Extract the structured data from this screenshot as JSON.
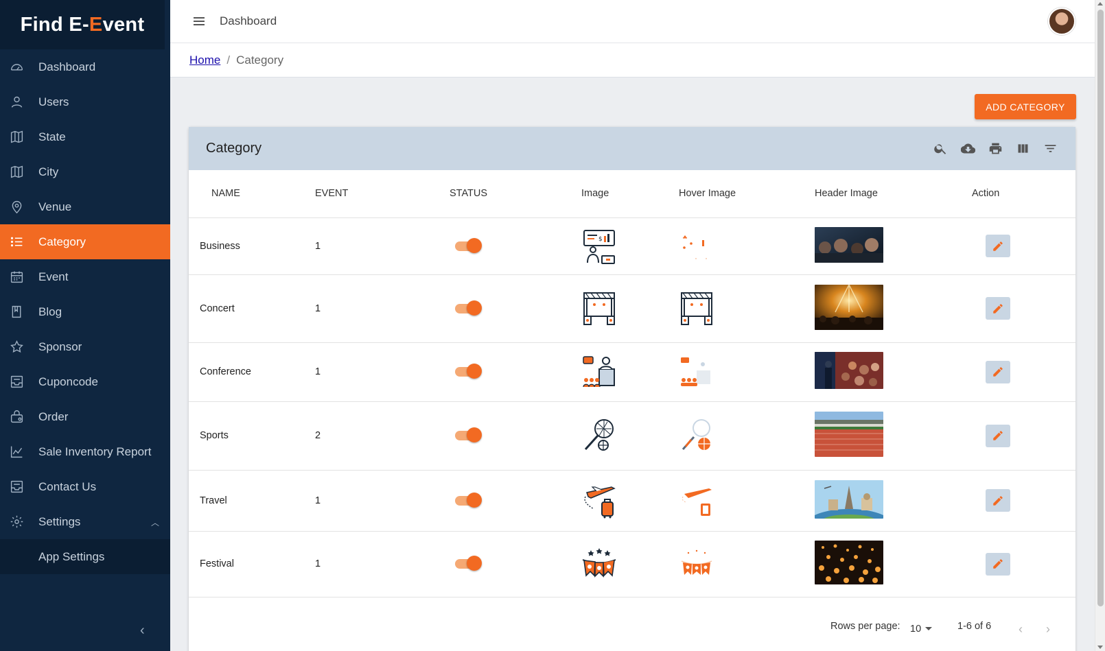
{
  "brand": {
    "part1": "Find E-",
    "part2": "E",
    "part3": "vent"
  },
  "sidebar": {
    "items": [
      {
        "label": "Dashboard",
        "icon": "dashboard-icon"
      },
      {
        "label": "Users",
        "icon": "user-icon"
      },
      {
        "label": "State",
        "icon": "map-icon"
      },
      {
        "label": "City",
        "icon": "map-icon"
      },
      {
        "label": "Venue",
        "icon": "location-pin-icon"
      },
      {
        "label": "Category",
        "icon": "list-icon",
        "active": true
      },
      {
        "label": "Event",
        "icon": "calendar-icon"
      },
      {
        "label": "Blog",
        "icon": "book-icon"
      },
      {
        "label": "Sponsor",
        "icon": "star-icon"
      },
      {
        "label": "Cuponcode",
        "icon": "inbox-icon"
      },
      {
        "label": "Order",
        "icon": "bag-icon"
      },
      {
        "label": "Sale Inventory Report",
        "icon": "chart-line-icon"
      },
      {
        "label": "Contact Us",
        "icon": "inbox-icon"
      },
      {
        "label": "Settings",
        "icon": "gear-icon"
      }
    ],
    "sub_items": [
      {
        "label": "App Settings"
      }
    ]
  },
  "topbar": {
    "title": "Dashboard"
  },
  "breadcrumb": {
    "home": "Home",
    "separator": "/",
    "current": "Category"
  },
  "add_button": "ADD CATEGORY",
  "card": {
    "title": "Category",
    "tools": [
      "search-icon",
      "download-icon",
      "print-icon",
      "columns-icon",
      "filter-icon"
    ]
  },
  "table": {
    "headers": [
      "NAME",
      "EVENT",
      "STATUS",
      "Image",
      "Hover Image",
      "Header Image",
      "Action"
    ],
    "rows": [
      {
        "name": "Business",
        "event": "1",
        "status": true
      },
      {
        "name": "Concert",
        "event": "1",
        "status": true
      },
      {
        "name": "Conference",
        "event": "1",
        "status": true
      },
      {
        "name": "Sports",
        "event": "2",
        "status": true
      },
      {
        "name": "Travel",
        "event": "1",
        "status": true
      },
      {
        "name": "Festival",
        "event": "1",
        "status": true
      }
    ]
  },
  "footer": {
    "rows_per_page_label": "Rows per page:",
    "rows_per_page": "10",
    "range": "1-6 of 6"
  },
  "colors": {
    "accent": "#f26a22",
    "sidebar": "#0f2640",
    "card_header": "#c9d6e3"
  }
}
